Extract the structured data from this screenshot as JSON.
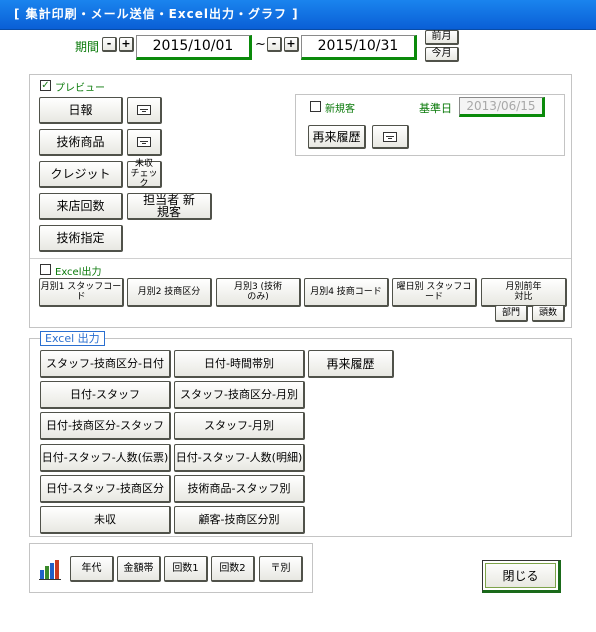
{
  "title": "[ 集計印刷・メール送信・Excel出力・グラフ ]",
  "period": {
    "label": "期間",
    "minus": "-",
    "plus": "+",
    "from": "2015/10/01",
    "tilde": "~",
    "to": "2015/10/31",
    "prev_month": "前月",
    "this_month": "今月"
  },
  "preview": {
    "label": "プレビュー",
    "checked": true,
    "check_mark": "✓",
    "buttons": {
      "daily": "日報",
      "tech_product": "技術商品",
      "credit": "クレジット",
      "uncollected_check": "未収 チェック",
      "visit_count": "来店回数",
      "staff_new": "担当者 新規客",
      "tech_spec": "技術指定"
    },
    "new_customer": "新規客",
    "base_date_label": "基準日",
    "base_date": "2013/06/15",
    "revisit_history": "再来履歴"
  },
  "excel_check": {
    "label": "Excel出力",
    "buttons": {
      "monthly1": "月別1 スタッフコード",
      "monthly2": "月別2 技商区分",
      "monthly3": "月別3 (技術のみ)",
      "monthly4": "月別4 技商コード",
      "weekday": "曜日別 スタッフコード",
      "prev_year": "月別前年 対比",
      "dept": "部門",
      "head": "頭数"
    }
  },
  "excel_output": {
    "legend": "Excel 出力",
    "buttons": {
      "b1": "スタッフ-技商区分-日付",
      "b2": "日付-時間帯別",
      "b3": "再来履歴",
      "b4": "日付-スタッフ",
      "b5": "スタッフ-技商区分-月別",
      "b6": "日付-技商区分-スタッフ",
      "b7": "スタッフ-月別",
      "b8": "日付-スタッフ-人数(伝票)",
      "b9": "日付-スタッフ-人数(明細)",
      "b10": "日付-スタッフ-技商区分",
      "b11": "技術商品-スタッフ別",
      "b12": "未収",
      "b13": "顧客-技商区分別"
    }
  },
  "graph": {
    "icon": "bar-chart-icon",
    "buttons": {
      "age": "年代",
      "amount": "金額帯",
      "count1": "回数1",
      "count2": "回数2",
      "postal": "〒別"
    }
  },
  "close": "閉じる",
  "colors": {
    "title_bar": "#0a5fd6",
    "accent_green": "#0a8a0a",
    "legend_blue": "#2a6fd0"
  }
}
